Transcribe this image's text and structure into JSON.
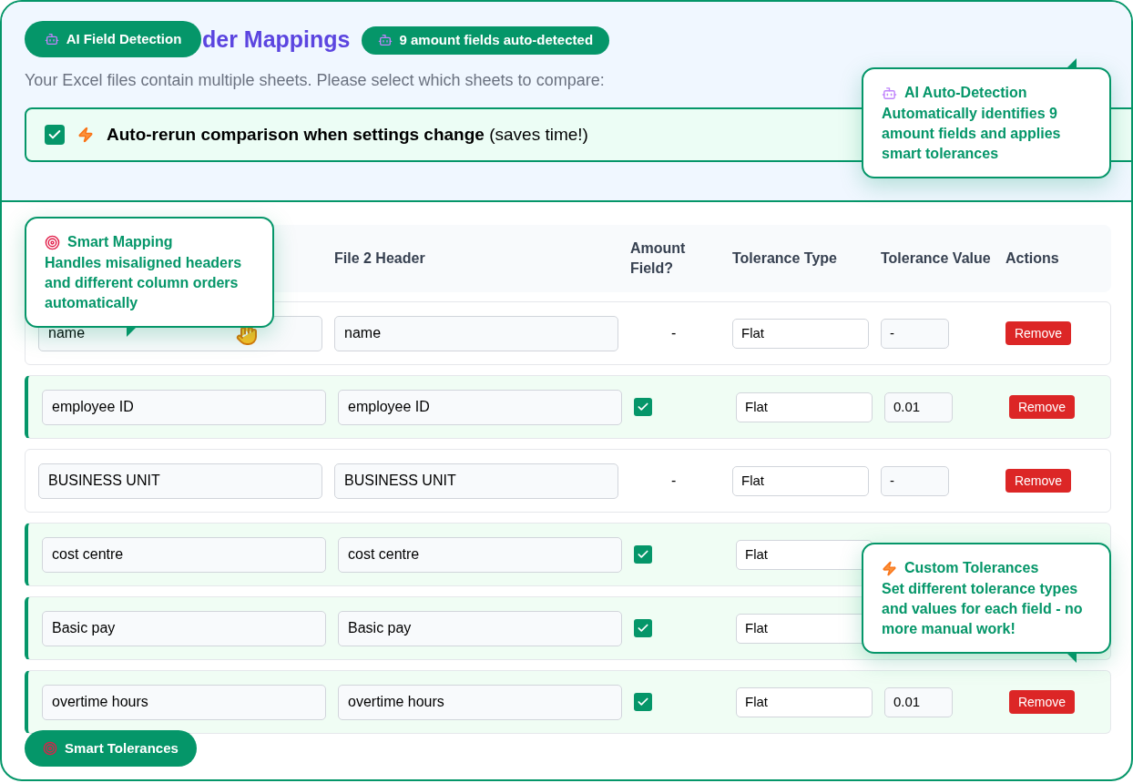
{
  "header": {
    "ai_pill": "AI Field Detection",
    "title": "der Mappings",
    "badge": "9 amount fields auto-detected",
    "subtitle": "Your Excel files contain multiple sheets. Please select which sheets to compare:"
  },
  "auto_rerun": {
    "checked": true,
    "label": "Auto-rerun comparison when settings change",
    "note": "(saves time!)"
  },
  "table": {
    "columns": [
      "File 2 Header",
      "Amount Field?",
      "Tolerance Type",
      "Tolerance Value",
      "Actions"
    ],
    "rows": [
      {
        "file1": "name",
        "file2": "name",
        "amount_field": false,
        "amount_text": "-",
        "tolerance_type": "Flat",
        "tolerance_value": "-",
        "action": "Remove"
      },
      {
        "file1": "employee ID",
        "file2": "employee ID",
        "amount_field": true,
        "tolerance_type": "Flat",
        "tolerance_value": "0.01",
        "action": "Remove"
      },
      {
        "file1": "BUSINESS UNIT",
        "file2": "BUSINESS UNIT",
        "amount_field": false,
        "amount_text": "-",
        "tolerance_type": "Flat",
        "tolerance_value": "-",
        "action": "Remove"
      },
      {
        "file1": "cost centre",
        "file2": "cost centre",
        "amount_field": true,
        "tolerance_type": "Flat"
      },
      {
        "file1": "Basic pay",
        "file2": "Basic pay",
        "amount_field": true,
        "tolerance_type": "Flat"
      },
      {
        "file1": "overtime hours",
        "file2": "overtime hours",
        "amount_field": true,
        "tolerance_type": "Flat",
        "tolerance_value": "0.01",
        "action": "Remove"
      }
    ]
  },
  "tooltips": [
    {
      "kind": "robot",
      "title": "AI Auto-Detection",
      "text": "Automatically identifies 9 amount fields and applies smart tolerances"
    },
    {
      "kind": "target",
      "title": "Smart Mapping",
      "text": "Handles misaligned headers and different column orders automatically"
    },
    {
      "kind": "bolt",
      "title": "Custom Tolerances",
      "text": "Set different tolerance types and values for each field - no more manual work!"
    }
  ],
  "bottom_pill": "Smart Tolerances"
}
